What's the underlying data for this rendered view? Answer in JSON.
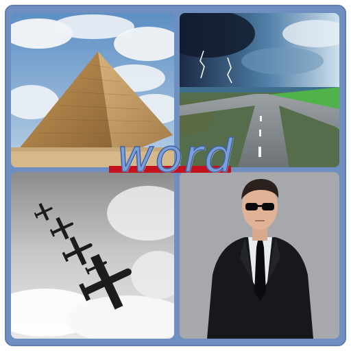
{
  "puzzle": {
    "title_word": "word",
    "tiles": [
      {
        "name": "pyramid-picture"
      },
      {
        "name": "road-fork-storm-picture"
      },
      {
        "name": "bomber-planes-picture"
      },
      {
        "name": "man-in-suit-picture"
      }
    ]
  },
  "colors": {
    "frame": "#6f8fc0",
    "word_fill": "#7b9fd6",
    "word_outline": "#3f62a3",
    "accent_bar": "#c3121e"
  }
}
